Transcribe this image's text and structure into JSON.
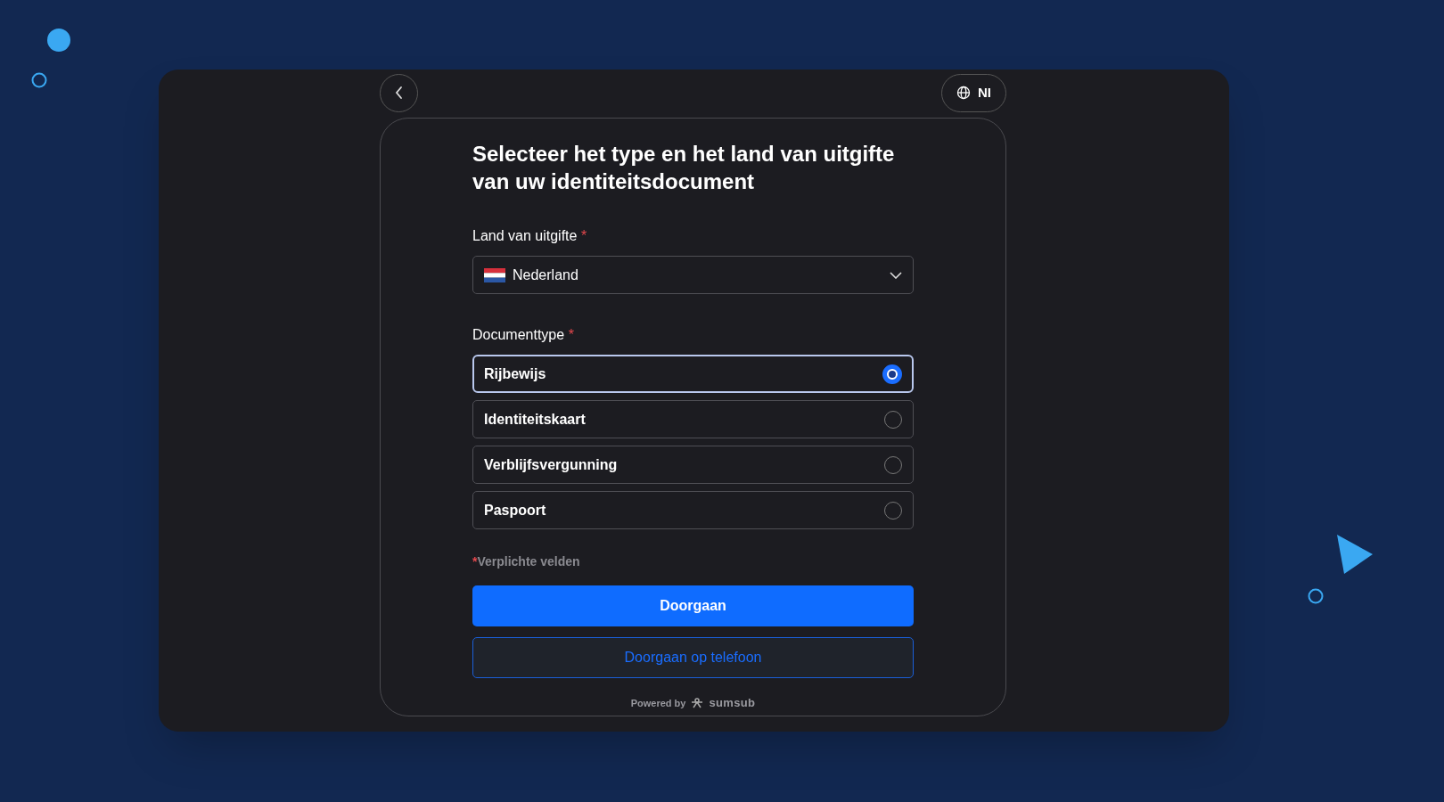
{
  "language_button": {
    "label": "NI"
  },
  "heading": "Selecteer het type en het land van uitgifte van uw identiteitsdocument",
  "country_field": {
    "label": "Land van uitgifte",
    "required_mark": "*",
    "value": "Nederland"
  },
  "document_type": {
    "label": "Documenttype",
    "required_mark": "*",
    "options": [
      {
        "label": "Rijbewijs",
        "selected": true
      },
      {
        "label": "Identiteitskaart",
        "selected": false
      },
      {
        "label": "Verblijfsvergunning",
        "selected": false
      },
      {
        "label": "Paspoort",
        "selected": false
      }
    ]
  },
  "required_note": {
    "mark": "*",
    "text": "Verplichte velden"
  },
  "buttons": [
    {
      "kind": "primary",
      "label": "Doorgaan"
    },
    {
      "kind": "outline",
      "label": "Doorgaan op telefoon"
    }
  ],
  "footer": {
    "powered_by": "Powered by",
    "brand": "sumsub"
  }
}
